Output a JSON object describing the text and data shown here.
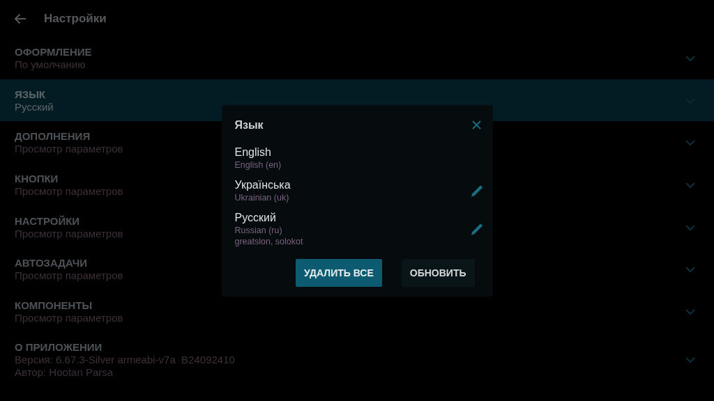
{
  "header": {
    "title": "Настройки"
  },
  "sections": [
    {
      "title": "ОФОРМЛЕНИЕ",
      "lines": [
        "По умолчанию"
      ],
      "selected": false
    },
    {
      "title": "ЯЗЫК",
      "lines": [
        "Русский"
      ],
      "selected": true
    },
    {
      "title": "ДОПОЛНЕНИЯ",
      "lines": [
        "Просмотр параметров"
      ],
      "selected": false
    },
    {
      "title": "КНОПКИ",
      "lines": [
        "Просмотр параметров"
      ],
      "selected": false
    },
    {
      "title": "НАСТРОЙКИ",
      "lines": [
        "Просмотр параметров"
      ],
      "selected": false
    },
    {
      "title": "АВТОЗАДАЧИ",
      "lines": [
        "Просмотр параметров"
      ],
      "selected": false
    },
    {
      "title": "КОМПОНЕНТЫ",
      "lines": [
        "Просмотр параметров"
      ],
      "selected": false
    },
    {
      "title": "О ПРИЛОЖЕНИИ",
      "lines": [
        "Версия: 6.67.3-Silver armeabi-v7a  B24092410",
        "Автор: Hootan Parsa"
      ],
      "selected": false
    }
  ],
  "dialog": {
    "title": "Язык",
    "languages": [
      {
        "name": "English",
        "details": [
          "English (en)"
        ],
        "editable": false
      },
      {
        "name": "Українська",
        "details": [
          "Ukrainian (uk)"
        ],
        "editable": true
      },
      {
        "name": "Русский",
        "details": [
          "Russian (ru)",
          "greatslon, solokot"
        ],
        "editable": true
      }
    ],
    "buttons": [
      {
        "label": "УДАЛИТЬ ВСЕ",
        "kind": "primary"
      },
      {
        "label": "ОБНОВИТЬ",
        "kind": "secondary"
      }
    ]
  }
}
